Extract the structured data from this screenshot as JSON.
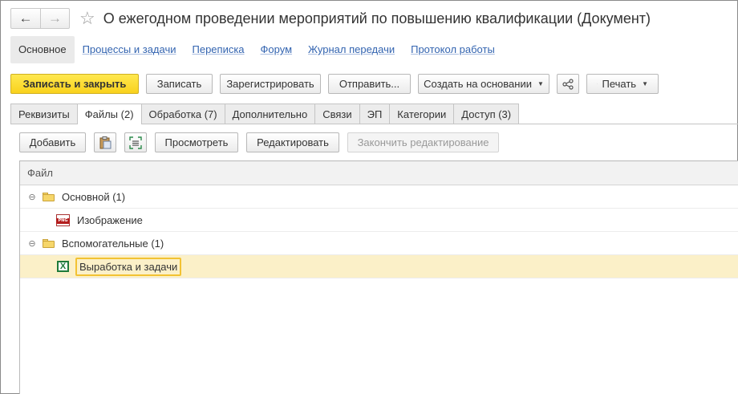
{
  "window": {
    "title": "О ежегодном проведении мероприятий по повышению квалификации (Документ)",
    "back_icon": "←",
    "forward_icon": "→",
    "star_icon": "☆"
  },
  "sections": [
    {
      "label": "Основное",
      "active": true
    },
    {
      "label": "Процессы и задачи"
    },
    {
      "label": "Переписка"
    },
    {
      "label": "Форум"
    },
    {
      "label": "Журнал передачи"
    },
    {
      "label": "Протокол работы"
    }
  ],
  "toolbar": {
    "save_close": "Записать и закрыть",
    "save": "Записать",
    "register": "Зарегистрировать",
    "send": "Отправить...",
    "create_based": "Создать на основании",
    "print": "Печать"
  },
  "tabs": [
    {
      "label": "Реквизиты"
    },
    {
      "label": "Файлы (2)",
      "active": true
    },
    {
      "label": "Обработка (7)"
    },
    {
      "label": "Дополнительно"
    },
    {
      "label": "Связи"
    },
    {
      "label": "ЭП"
    },
    {
      "label": "Категории"
    },
    {
      "label": "Доступ (3)"
    }
  ],
  "files_toolbar": {
    "add": "Добавить",
    "view": "Просмотреть",
    "edit": "Редактировать",
    "finish_edit": "Закончить редактирование"
  },
  "table": {
    "header": "Файл",
    "rows": [
      {
        "kind": "group",
        "label": "Основной (1)",
        "toggle": "⊖"
      },
      {
        "kind": "file",
        "label": "Изображение",
        "icon": "png-file-icon",
        "icon_text": "PNG"
      },
      {
        "kind": "group",
        "label": "Вспомогательные (1)",
        "toggle": "⊖"
      },
      {
        "kind": "file",
        "label": "Выработка и задачи",
        "icon": "excel-file-icon",
        "icon_text": "X",
        "selected": true
      }
    ]
  }
}
